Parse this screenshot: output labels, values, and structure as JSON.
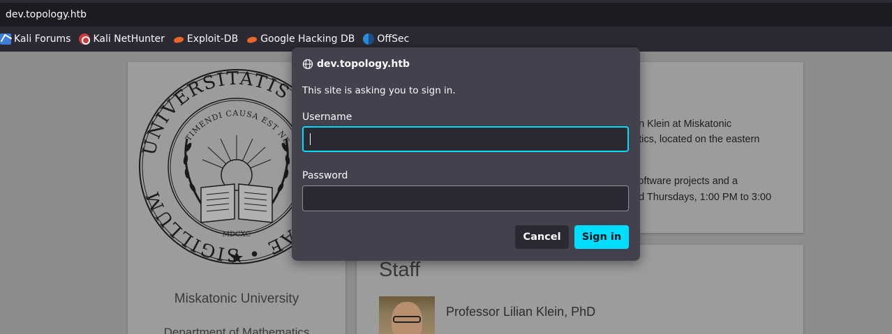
{
  "browser": {
    "url": "dev.topology.htb",
    "bookmarks": [
      {
        "label": "Kali Forums",
        "icon": "kali-icon"
      },
      {
        "label": "Kali NetHunter",
        "icon": "nethunter-icon"
      },
      {
        "label": "Exploit-DB",
        "icon": "exploit-db-icon"
      },
      {
        "label": "Google Hacking DB",
        "icon": "ghdb-icon"
      },
      {
        "label": "OffSec",
        "icon": "offsec-icon"
      }
    ]
  },
  "page": {
    "seal": {
      "outer_text": "UNIVERSITATIS MISKATONICAE • SIGILLUM",
      "inner_text": "TIMENDI CAUSA EST NESCIRE",
      "year": "MDCXC"
    },
    "university": "Miskatonic University",
    "department": "Department of Mathematics",
    "partial_lines": [
      "an Klein at Miskatonic",
      "atics, located on the eastern",
      "software projects and a",
      "nd Thursdays, 1:00 PM to 3:00"
    ],
    "staff_heading": "Staff",
    "staff_name": "Professor Lilian Klein, PhD"
  },
  "dialog": {
    "host": "dev.topology.htb",
    "message": "This site is asking you to sign in.",
    "username_label": "Username",
    "username_value": "",
    "password_label": "Password",
    "password_value": "",
    "cancel_label": "Cancel",
    "signin_label": "Sign in",
    "accent_color": "#00ddff"
  }
}
